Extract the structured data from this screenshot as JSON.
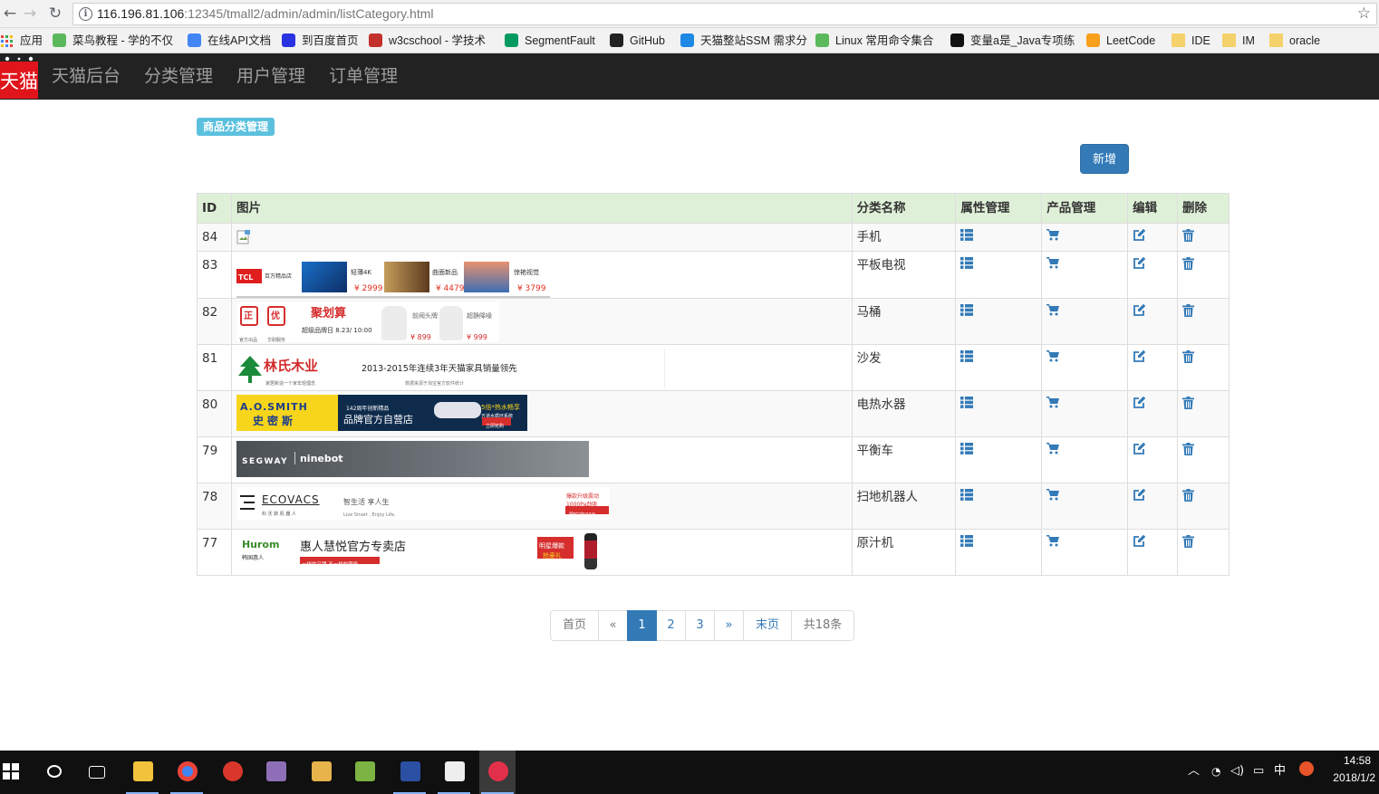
{
  "browser": {
    "url_host": "116.196.81.106",
    "url_rest": ":12345/tmall2/admin/admin/listCategory.html",
    "bookmarks": [
      {
        "label": "应用",
        "icon": "apps-grid-icon",
        "color": "#e94235"
      },
      {
        "label": "菜鸟教程 - 学的不仅",
        "icon": "runoob-icon",
        "color": "#5cb85c"
      },
      {
        "label": "在线API文档",
        "icon": "chrome-app-icon",
        "color": "#4285f4"
      },
      {
        "label": "到百度首页",
        "icon": "baidu-paw-icon",
        "color": "#2932e1"
      },
      {
        "label": "w3cschool - 学技术",
        "icon": "w3c-icon",
        "color": "#c4302b"
      },
      {
        "label": "SegmentFault",
        "icon": "segmentfault-icon",
        "color": "#009a61"
      },
      {
        "label": "GitHub",
        "icon": "github-icon",
        "color": "#222222"
      },
      {
        "label": "天猫整站SSM 需求分",
        "icon": "how2j-icon",
        "color": "#1e88e5"
      },
      {
        "label": "Linux 常用命令集合",
        "icon": "runoob-icon",
        "color": "#5cb85c"
      },
      {
        "label": "变量a是_Java专项练",
        "icon": "nowcoder-icon",
        "color": "#111111"
      },
      {
        "label": "LeetCode",
        "icon": "leetcode-icon",
        "color": "#f89f1b"
      },
      {
        "label": "IDE",
        "icon": "folder-icon",
        "color": "#f5d16b"
      },
      {
        "label": "IM",
        "icon": "folder-icon",
        "color": "#f5d16b"
      },
      {
        "label": "oracle",
        "icon": "folder-icon",
        "color": "#f5d16b"
      }
    ]
  },
  "nav": {
    "logo_text": "天猫",
    "links": [
      "天猫后台",
      "分类管理",
      "用户管理",
      "订单管理"
    ]
  },
  "page": {
    "label": "商品分类管理",
    "add_button": "新增"
  },
  "table": {
    "headers": [
      "ID",
      "图片",
      "分类名称",
      "属性管理",
      "产品管理",
      "编辑",
      "删除"
    ],
    "rows": [
      {
        "id": "84",
        "name": "手机",
        "banner": "broken"
      },
      {
        "id": "83",
        "name": "平板电视",
        "banner": "tcl"
      },
      {
        "id": "82",
        "name": "马桶",
        "banner": "toilet"
      },
      {
        "id": "81",
        "name": "沙发",
        "banner": "linshi"
      },
      {
        "id": "80",
        "name": "电热水器",
        "banner": "aosmith"
      },
      {
        "id": "79",
        "name": "平衡车",
        "banner": "segway"
      },
      {
        "id": "78",
        "name": "扫地机器人",
        "banner": "ecovacs"
      },
      {
        "id": "77",
        "name": "原汁机",
        "banner": "hurom"
      }
    ],
    "banners": {
      "tcl": {
        "brand": "TCL",
        "slogan": "百万精品店",
        "items": [
          {
            "title": "轻薄4K",
            "price": "¥ 2999"
          },
          {
            "title": "曲面新品",
            "price": "¥ 4479"
          },
          {
            "title": "惊艳视觉",
            "price": "¥ 3799"
          }
        ]
      },
      "toilet": {
        "badge1": "正",
        "badge2": "优",
        "title": "聚划算",
        "sub": "超级品牌日 8.23/ 10:00",
        "note1": "官方出品",
        "note2": "华耐服务",
        "p1": "¥ 899",
        "p2": "¥ 999",
        "t1": "前阀头牌",
        "t2": "超静降噪",
        "tag": "聚"
      },
      "linshi": {
        "brand": "林氏木业",
        "sub": "家居新造一个家年轻理念",
        "headline": "2013-2015年连续3年天猫家具销量领先",
        "note": "数据来源于淘宝官方软件统计"
      },
      "aosmith": {
        "brand": "A.O.SMITH",
        "cn": "史密斯",
        "year": "142周年创新精品",
        "store": "品牌官方自营店",
        "promo": "5倍*热水畅享",
        "promo_sub": "五道水循环系统",
        "cta": "立即抢购"
      },
      "segway": {
        "brand": "SEGWAY",
        "sub": "ninebot"
      },
      "ecovacs": {
        "brand": "ECOVACS",
        "cn": "科 沃 斯 机 器 人",
        "slogan": "智生活 享人生",
        "slogan_en": "Live Smart , Enjoy Life.",
        "promo": "爆款升级震动",
        "promo2": "1000Pa劲吸",
        "promo3": "限时减500元"
      },
      "hurom": {
        "brand": "Hurom",
        "cn": "韩国惠人",
        "store": "惠人慧悦官方专卖店",
        "tag1": "一样的品牌 不一样的服务",
        "tag2": "明星爆款",
        "tag3": "抢豪礼"
      }
    }
  },
  "pagination": {
    "items": [
      "首页",
      "«",
      "1",
      "2",
      "3",
      "»",
      "末页",
      "共18条"
    ],
    "active": "1"
  },
  "taskbar": {
    "time": "14:58",
    "date": "2018/1/2",
    "ime": "中"
  }
}
